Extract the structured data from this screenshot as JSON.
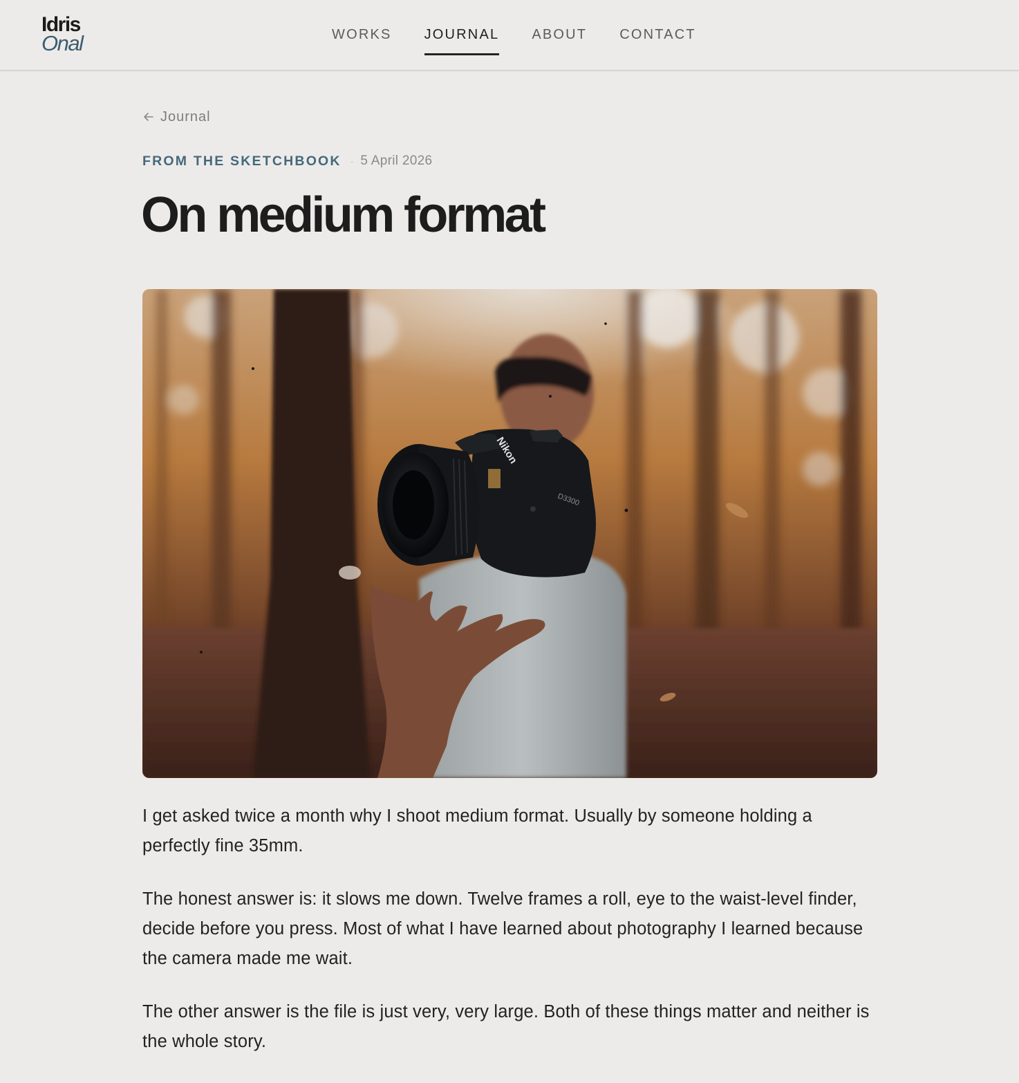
{
  "header": {
    "logo": {
      "first": "Idris",
      "last": "Onal"
    },
    "nav": [
      {
        "label": "WORKS",
        "active": false
      },
      {
        "label": "JOURNAL",
        "active": true
      },
      {
        "label": "ABOUT",
        "active": false
      },
      {
        "label": "CONTACT",
        "active": false
      }
    ]
  },
  "article": {
    "back_label": "Journal",
    "category": "FROM THE SKETCHBOOK",
    "meta_separator": "·",
    "date": "5 April 2026",
    "title": "On medium format",
    "hero": {
      "icon": "photo",
      "camera_brand": "Nikon",
      "camera_model": "D3300"
    },
    "paragraphs": [
      "I get asked twice a month why I shoot medium format. Usually by someone holding a perfectly fine 35mm.",
      "The honest answer is: it slows me down. Twelve frames a roll, eye to the waist-level finder, decide before you press. Most of what I have learned about photography I learned because the camera made me wait.",
      "The other answer is the file is just very, very large. Both of these things matter and neither is the whole story."
    ]
  },
  "colors": {
    "background": "#edebe9",
    "accent": "#44697c",
    "text": "#1f1f1f",
    "muted": "#7d7d7d"
  }
}
